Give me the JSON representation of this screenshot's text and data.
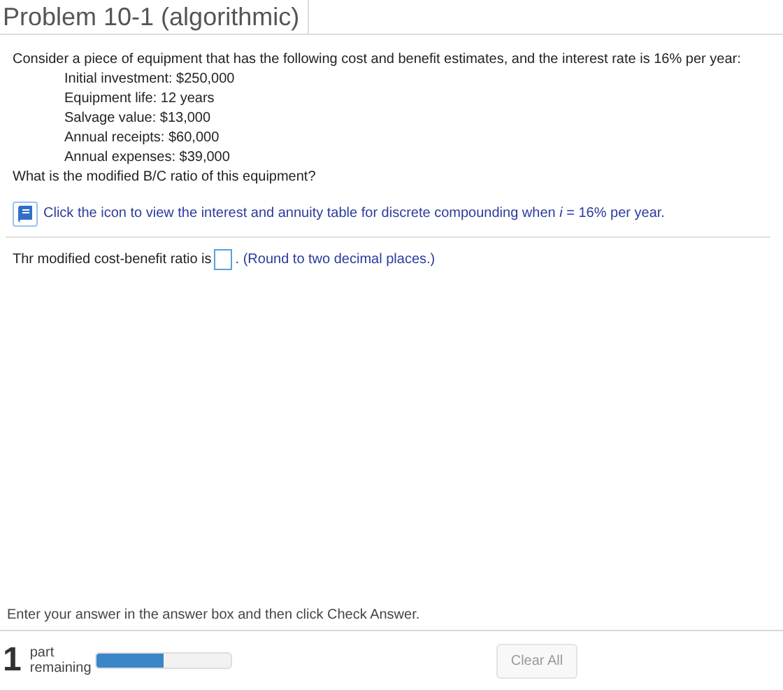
{
  "title": "Problem 10-1 (algorithmic)",
  "intro": "Consider a piece of equipment that has the following cost and benefit estimates, and the interest rate is 16% per year:",
  "estimates": [
    "Initial investment: $250,000",
    "Equipment life: 12 years",
    "Salvage value: $13,000",
    "Annual receipts: $60,000",
    "Annual expenses: $39,000"
  ],
  "question": "What is the modified B/C ratio of this equipment?",
  "table_link": "Click the icon to view the interest and annuity table for discrete compounding when *i* = 16% per year.",
  "answer": {
    "prefix": "Thr modified cost-benefit ratio is",
    "suffix": ". (Round to two decimal places.)"
  },
  "instruction": "Enter your answer in the answer box and then click Check Answer.",
  "footer": {
    "count": "1",
    "count_label": "part remaining",
    "progress": {
      "level": 0.5
    },
    "clear_button": "Clear All"
  }
}
